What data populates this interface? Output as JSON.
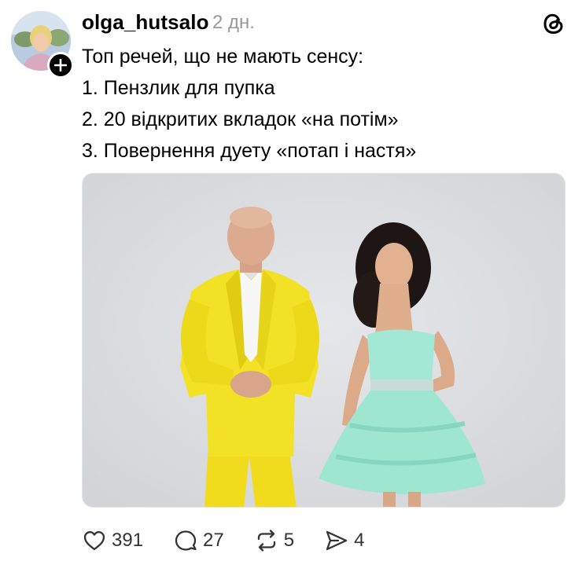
{
  "post": {
    "author": "olga_hutsalo",
    "timestamp": "2 дн.",
    "lines": [
      "Топ речей, що не мають сенсу:",
      "1. Пензлик для пупка",
      "2. 20 відкритих вкладок «на потім»",
      "3. Повернення дуету «потап і настя»"
    ]
  },
  "actions": {
    "likes": "391",
    "replies": "27",
    "reposts": "5",
    "shares": "4"
  },
  "icons": {
    "brand": "threads-logo-icon",
    "follow": "plus-icon",
    "like": "heart-icon",
    "reply": "comment-icon",
    "repost": "repost-icon",
    "share": "send-icon"
  },
  "colors": {
    "text": "#000000",
    "muted": "#999999",
    "photo_background": "#dadbdf",
    "suit": "#f3e126",
    "dress": "#9ee6d0"
  }
}
